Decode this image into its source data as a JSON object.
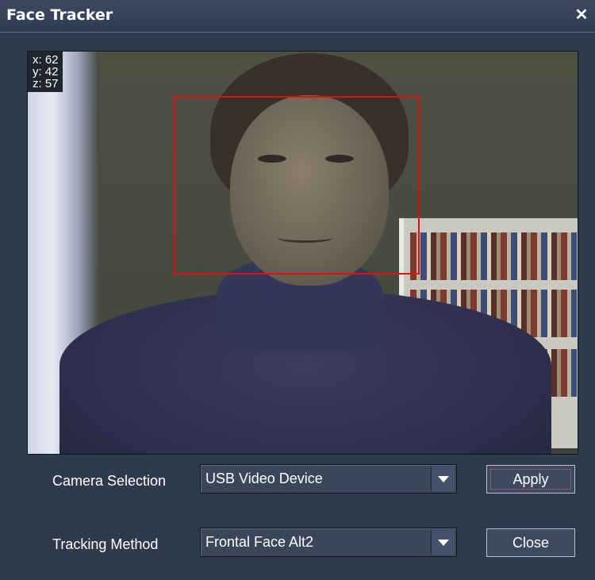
{
  "window": {
    "title": "Face Tracker",
    "close_glyph": "✕"
  },
  "tracking": {
    "x": "x: 62",
    "y": "y: 42",
    "z": "z: 57"
  },
  "camera": {
    "label": "Camera Selection",
    "value": "USB Video Device"
  },
  "method": {
    "label": "Tracking Method",
    "value": "Frontal Face Alt2"
  },
  "buttons": {
    "apply": "Apply",
    "close": "Close"
  },
  "colors": {
    "face_box": "#e01010",
    "background": "#2f3a4d"
  }
}
